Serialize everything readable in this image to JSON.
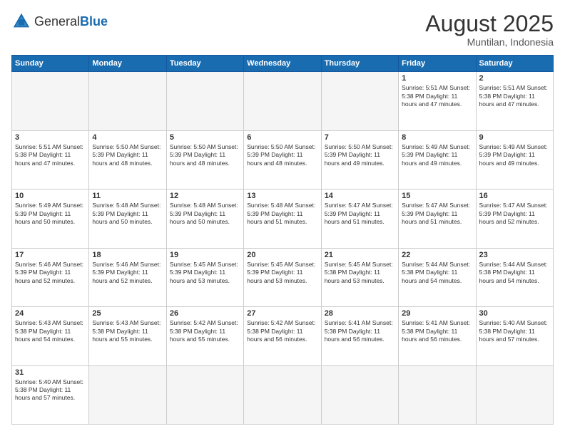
{
  "header": {
    "logo": {
      "general": "General",
      "blue": "Blue"
    },
    "title": "August 2025",
    "location": "Muntilan, Indonesia"
  },
  "days": [
    "Sunday",
    "Monday",
    "Tuesday",
    "Wednesday",
    "Thursday",
    "Friday",
    "Saturday"
  ],
  "weeks": [
    [
      {
        "date": "",
        "info": "",
        "empty": true
      },
      {
        "date": "",
        "info": "",
        "empty": true
      },
      {
        "date": "",
        "info": "",
        "empty": true
      },
      {
        "date": "",
        "info": "",
        "empty": true
      },
      {
        "date": "",
        "info": "",
        "empty": true
      },
      {
        "date": "1",
        "info": "Sunrise: 5:51 AM\nSunset: 5:38 PM\nDaylight: 11 hours\nand 47 minutes."
      },
      {
        "date": "2",
        "info": "Sunrise: 5:51 AM\nSunset: 5:38 PM\nDaylight: 11 hours\nand 47 minutes."
      }
    ],
    [
      {
        "date": "3",
        "info": "Sunrise: 5:51 AM\nSunset: 5:38 PM\nDaylight: 11 hours\nand 47 minutes."
      },
      {
        "date": "4",
        "info": "Sunrise: 5:50 AM\nSunset: 5:39 PM\nDaylight: 11 hours\nand 48 minutes."
      },
      {
        "date": "5",
        "info": "Sunrise: 5:50 AM\nSunset: 5:39 PM\nDaylight: 11 hours\nand 48 minutes."
      },
      {
        "date": "6",
        "info": "Sunrise: 5:50 AM\nSunset: 5:39 PM\nDaylight: 11 hours\nand 48 minutes."
      },
      {
        "date": "7",
        "info": "Sunrise: 5:50 AM\nSunset: 5:39 PM\nDaylight: 11 hours\nand 49 minutes."
      },
      {
        "date": "8",
        "info": "Sunrise: 5:49 AM\nSunset: 5:39 PM\nDaylight: 11 hours\nand 49 minutes."
      },
      {
        "date": "9",
        "info": "Sunrise: 5:49 AM\nSunset: 5:39 PM\nDaylight: 11 hours\nand 49 minutes."
      }
    ],
    [
      {
        "date": "10",
        "info": "Sunrise: 5:49 AM\nSunset: 5:39 PM\nDaylight: 11 hours\nand 50 minutes."
      },
      {
        "date": "11",
        "info": "Sunrise: 5:48 AM\nSunset: 5:39 PM\nDaylight: 11 hours\nand 50 minutes."
      },
      {
        "date": "12",
        "info": "Sunrise: 5:48 AM\nSunset: 5:39 PM\nDaylight: 11 hours\nand 50 minutes."
      },
      {
        "date": "13",
        "info": "Sunrise: 5:48 AM\nSunset: 5:39 PM\nDaylight: 11 hours\nand 51 minutes."
      },
      {
        "date": "14",
        "info": "Sunrise: 5:47 AM\nSunset: 5:39 PM\nDaylight: 11 hours\nand 51 minutes."
      },
      {
        "date": "15",
        "info": "Sunrise: 5:47 AM\nSunset: 5:39 PM\nDaylight: 11 hours\nand 51 minutes."
      },
      {
        "date": "16",
        "info": "Sunrise: 5:47 AM\nSunset: 5:39 PM\nDaylight: 11 hours\nand 52 minutes."
      }
    ],
    [
      {
        "date": "17",
        "info": "Sunrise: 5:46 AM\nSunset: 5:39 PM\nDaylight: 11 hours\nand 52 minutes."
      },
      {
        "date": "18",
        "info": "Sunrise: 5:46 AM\nSunset: 5:39 PM\nDaylight: 11 hours\nand 52 minutes."
      },
      {
        "date": "19",
        "info": "Sunrise: 5:45 AM\nSunset: 5:39 PM\nDaylight: 11 hours\nand 53 minutes."
      },
      {
        "date": "20",
        "info": "Sunrise: 5:45 AM\nSunset: 5:39 PM\nDaylight: 11 hours\nand 53 minutes."
      },
      {
        "date": "21",
        "info": "Sunrise: 5:45 AM\nSunset: 5:38 PM\nDaylight: 11 hours\nand 53 minutes."
      },
      {
        "date": "22",
        "info": "Sunrise: 5:44 AM\nSunset: 5:38 PM\nDaylight: 11 hours\nand 54 minutes."
      },
      {
        "date": "23",
        "info": "Sunrise: 5:44 AM\nSunset: 5:38 PM\nDaylight: 11 hours\nand 54 minutes."
      }
    ],
    [
      {
        "date": "24",
        "info": "Sunrise: 5:43 AM\nSunset: 5:38 PM\nDaylight: 11 hours\nand 54 minutes."
      },
      {
        "date": "25",
        "info": "Sunrise: 5:43 AM\nSunset: 5:38 PM\nDaylight: 11 hours\nand 55 minutes."
      },
      {
        "date": "26",
        "info": "Sunrise: 5:42 AM\nSunset: 5:38 PM\nDaylight: 11 hours\nand 55 minutes."
      },
      {
        "date": "27",
        "info": "Sunrise: 5:42 AM\nSunset: 5:38 PM\nDaylight: 11 hours\nand 56 minutes."
      },
      {
        "date": "28",
        "info": "Sunrise: 5:41 AM\nSunset: 5:38 PM\nDaylight: 11 hours\nand 56 minutes."
      },
      {
        "date": "29",
        "info": "Sunrise: 5:41 AM\nSunset: 5:38 PM\nDaylight: 11 hours\nand 56 minutes."
      },
      {
        "date": "30",
        "info": "Sunrise: 5:40 AM\nSunset: 5:38 PM\nDaylight: 11 hours\nand 57 minutes."
      }
    ],
    [
      {
        "date": "31",
        "info": "Sunrise: 5:40 AM\nSunset: 5:38 PM\nDaylight: 11 hours\nand 57 minutes."
      },
      {
        "date": "",
        "info": "",
        "empty": true
      },
      {
        "date": "",
        "info": "",
        "empty": true
      },
      {
        "date": "",
        "info": "",
        "empty": true
      },
      {
        "date": "",
        "info": "",
        "empty": true
      },
      {
        "date": "",
        "info": "",
        "empty": true
      },
      {
        "date": "",
        "info": "",
        "empty": true
      }
    ]
  ]
}
